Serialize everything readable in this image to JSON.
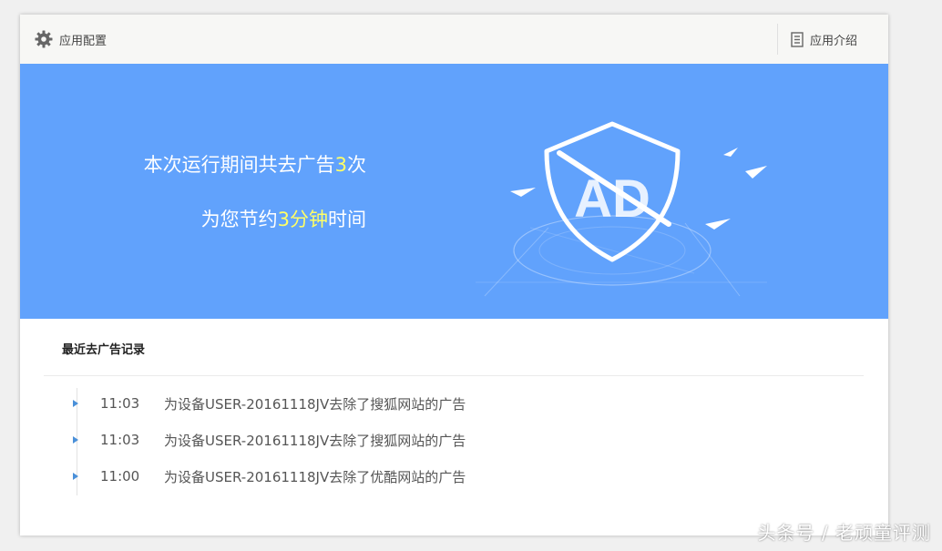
{
  "topbar": {
    "config_label": "应用配置",
    "config_icon": "gear-icon",
    "intro_label": "应用介绍",
    "intro_icon": "document-icon"
  },
  "banner": {
    "line1_prefix": "本次运行期间共去广告",
    "line1_count": "3",
    "line1_suffix": "次",
    "line2_prefix": "为您节约",
    "line2_value": "3分钟",
    "line2_suffix": "时间",
    "shield_text": "AD",
    "background_color": "#61a2fc",
    "highlight_color": "#ffff66"
  },
  "records": {
    "title": "最近去广告记录",
    "items": [
      {
        "time": "11:03",
        "text": "为设备USER-20161118JV去除了搜狐网站的广告"
      },
      {
        "time": "11:03",
        "text": "为设备USER-20161118JV去除了搜狐网站的广告"
      },
      {
        "time": "11:00",
        "text": "为设备USER-20161118JV去除了优酷网站的广告"
      }
    ]
  },
  "watermark": "头条号 / 老顽童评测"
}
